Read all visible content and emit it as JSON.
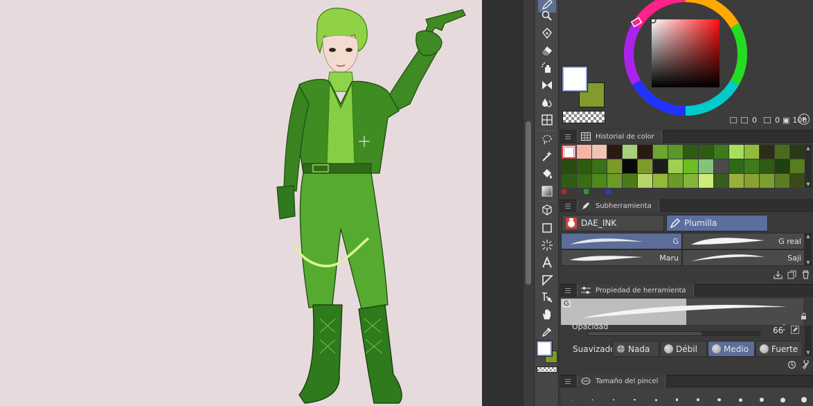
{
  "colors": {
    "main": "#ffffff",
    "sub": "#819b2c",
    "accent": "#5b6d98",
    "canvas": "#e7dadc"
  },
  "color_wheel": {
    "readout_s": "0",
    "readout_v": "0",
    "readout_v_icon": "▣",
    "readout_b": "100"
  },
  "color_history": {
    "title": "Historial de color",
    "swatches": [
      "#ffffff",
      "#f4b6a2",
      "#f2c2b4",
      "#2b1a12",
      "#a7d07a",
      "#2a1b12",
      "#6ca62c",
      "#5a9928",
      "#2d5c14",
      "#2e5c12",
      "#3c7a1a",
      "#a6e05a",
      "#8fbf3a",
      "#2b2d18",
      "#4b6b1c",
      "#2a3a14",
      "#2a4a10",
      "#2e5a12",
      "#3a7016",
      "#7a9a2a",
      "#090909",
      "#7f9a2c",
      "#1c1c1c",
      "#a0d050",
      "#6cbe24",
      "#86c37a",
      "#4a4a4a",
      "#2e6a18",
      "#3d7a1a",
      "#2f5a14",
      "#1f4010",
      "#567e1e",
      "#2f5c12",
      "#3b6c14",
      "#4d8a1c",
      "#6b9a2a",
      "#4a7a1a",
      "#b6d66a",
      "#94b838",
      "#6c9a2a",
      "#85b43a",
      "#cdea7a",
      "#3a5c1c",
      "#9ab03a",
      "#8aa034",
      "#7f9e30",
      "#5c7c22",
      "#3a4a18"
    ]
  },
  "sub_tool": {
    "title": "Subherramienta",
    "groups": [
      "DAE_INK",
      "Plumilla"
    ],
    "brushes": [
      {
        "label": "G"
      },
      {
        "label": "G real"
      },
      {
        "label": "Maru"
      },
      {
        "label": "Saji"
      }
    ]
  },
  "tool_property": {
    "title": "Propiedad de herramienta",
    "preview_label": "G",
    "opacity_label": "Opacidad",
    "opacity_value": "66",
    "opacity_percent": 0.66,
    "smoothing_label": "Suavizado",
    "smoothing_options": [
      "Nada",
      "Débil",
      "Medio",
      "Fuerte"
    ],
    "smoothing_selected": "Medio"
  },
  "brush_size": {
    "title": "Tamaño del pincel"
  }
}
